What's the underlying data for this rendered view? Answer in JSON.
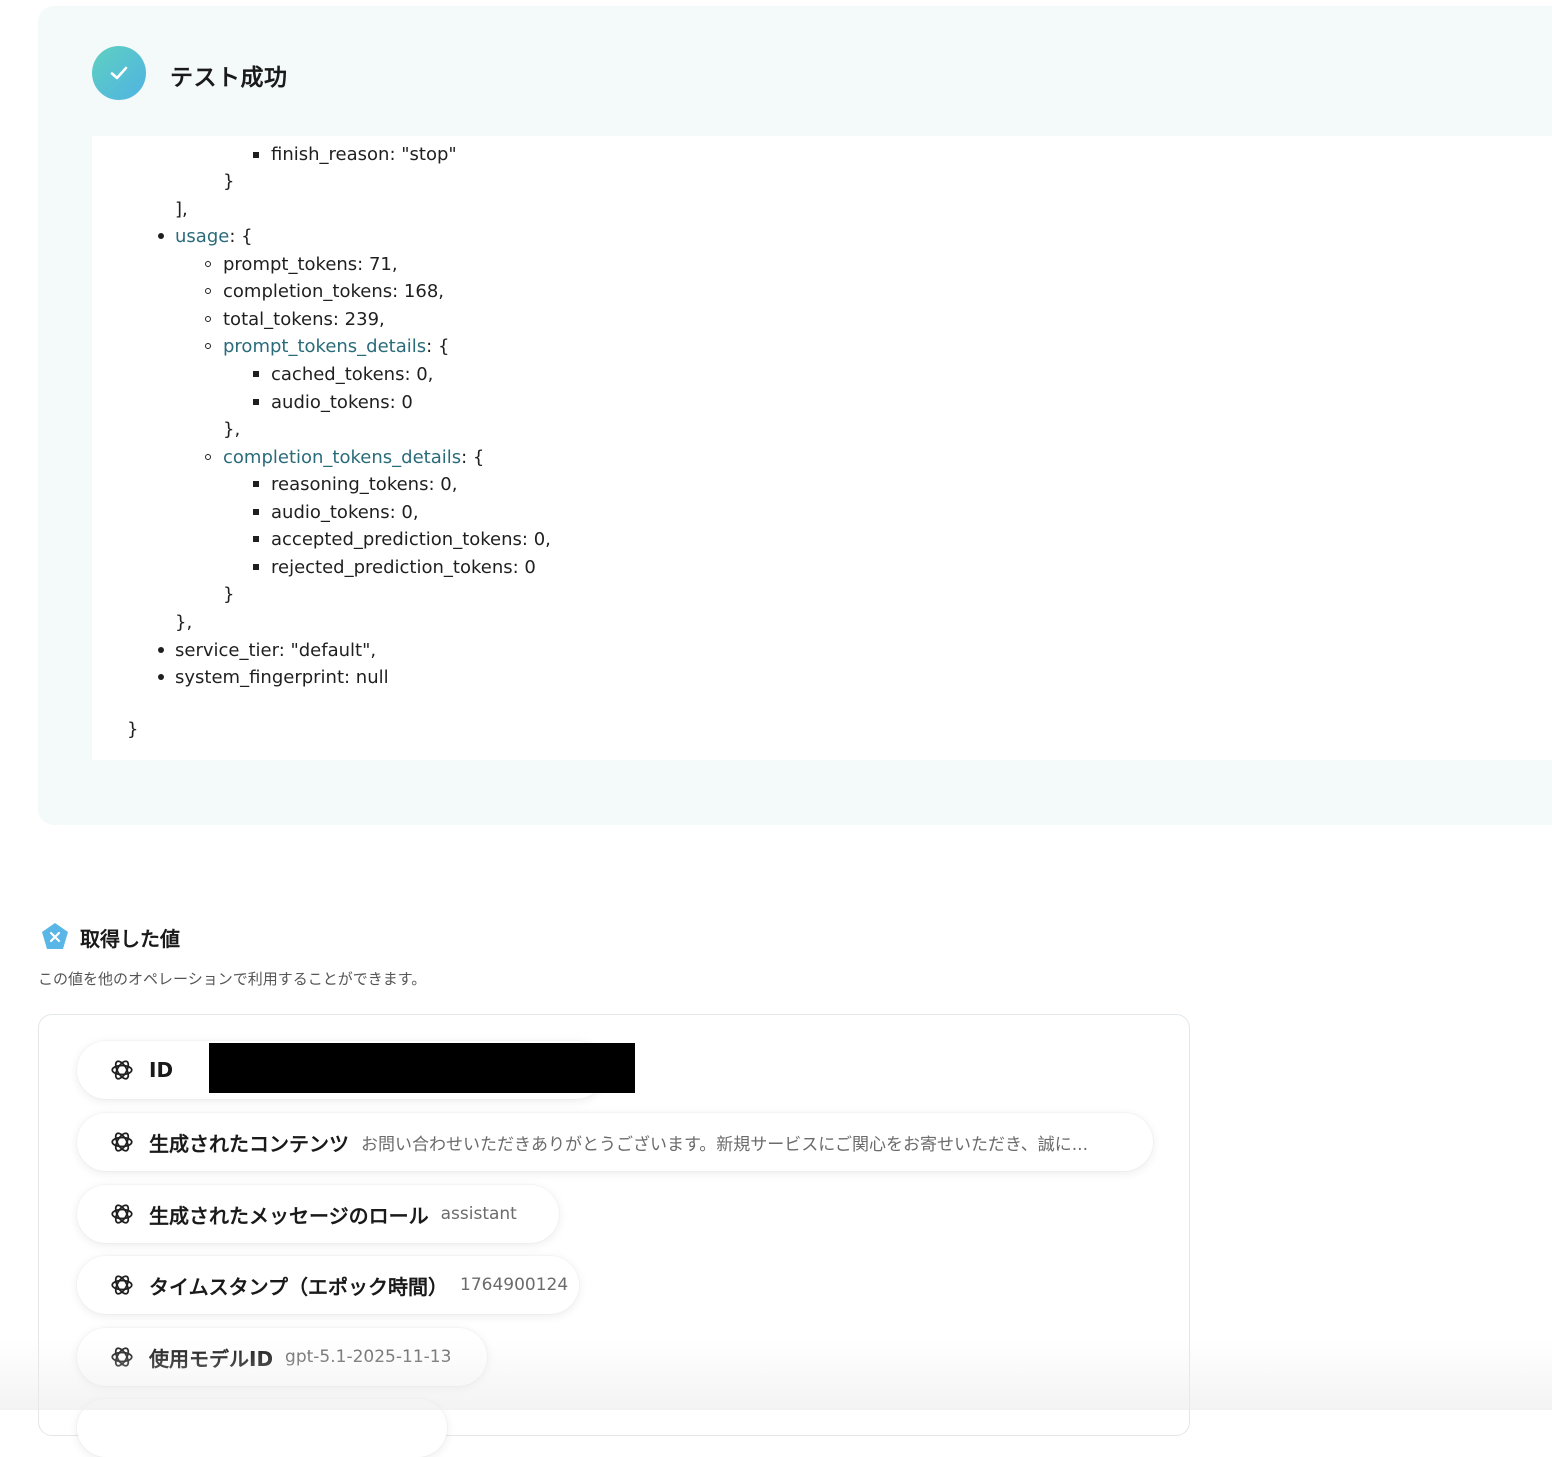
{
  "result": {
    "title": "テスト成功",
    "json_lines": [
      {
        "text": "finish_reason: \"stop\"",
        "bullet": "square"
      },
      {
        "text": "}"
      },
      {
        "text": "],"
      },
      {
        "key": "usage",
        "rest": ": {",
        "bullet": "disc"
      },
      {
        "text": "prompt_tokens: 71,",
        "bullet": "circle"
      },
      {
        "text": "completion_tokens: 168,",
        "bullet": "circle"
      },
      {
        "text": "total_tokens: 239,",
        "bullet": "circle"
      },
      {
        "key": "prompt_tokens_details",
        "rest": ": {",
        "bullet": "circle"
      },
      {
        "text": "cached_tokens: 0,",
        "bullet": "square"
      },
      {
        "text": "audio_tokens: 0",
        "bullet": "square"
      },
      {
        "text": "},"
      },
      {
        "key": "completion_tokens_details",
        "rest": ": {",
        "bullet": "circle"
      },
      {
        "text": "reasoning_tokens: 0,",
        "bullet": "square"
      },
      {
        "text": "audio_tokens: 0,",
        "bullet": "square"
      },
      {
        "text": "accepted_prediction_tokens: 0,",
        "bullet": "square"
      },
      {
        "text": "rejected_prediction_tokens: 0",
        "bullet": "square"
      },
      {
        "text": "}"
      },
      {
        "text": "},"
      },
      {
        "text": "service_tier: \"default\",",
        "bullet": "disc"
      },
      {
        "text": "system_fingerprint: null",
        "bullet": "disc"
      },
      {
        "text": "}"
      }
    ]
  },
  "values": {
    "title": "取得した値",
    "description": "この値を他のオペレーションで利用することができます。",
    "items": [
      {
        "label": "ID",
        "value": ""
      },
      {
        "label": "生成されたコンテンツ",
        "value": "お問い合わせいただきありがとうございます。新規サービスにご関心をお寄せいただき、誠に..."
      },
      {
        "label": "生成されたメッセージのロール",
        "value": "assistant"
      },
      {
        "label": "タイムスタンプ（エポック時間）",
        "value": "1764900124"
      },
      {
        "label": "使用モデルID",
        "value": "gpt-5.1-2025-11-13"
      }
    ]
  },
  "colors": {
    "accent": "#4fb3e3",
    "link_key": "#2a6b7a",
    "panel_bg": "#f4f9f9"
  },
  "icons": {
    "success": "check-icon",
    "values": "variable-x-icon",
    "chip": "openai-logo-icon"
  }
}
